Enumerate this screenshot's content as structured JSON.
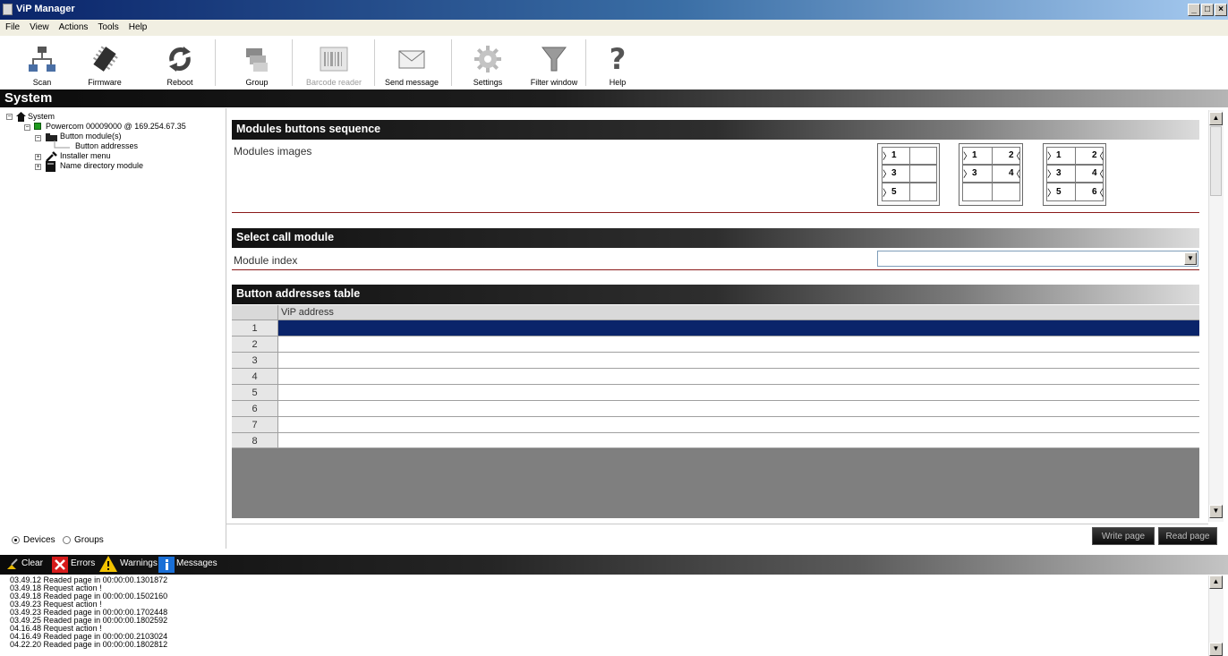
{
  "window": {
    "title": "ViP Manager",
    "controls": [
      "_",
      "□",
      "×"
    ]
  },
  "menu": [
    "File",
    "View",
    "Actions",
    "Tools",
    "Help"
  ],
  "toolbar": [
    {
      "label": "Scan",
      "icon": "network-icon",
      "enabled": true
    },
    {
      "label": "Firmware",
      "icon": "chip-icon",
      "enabled": true
    },
    {
      "label": "Reboot",
      "icon": "reboot-arrows-icon",
      "enabled": true
    },
    {
      "label": "Group",
      "icon": "group-icon",
      "enabled": true
    },
    {
      "label": "Barcode reader",
      "icon": "barcode-icon",
      "enabled": false
    },
    {
      "label": "Send message",
      "icon": "envelope-icon",
      "enabled": true
    },
    {
      "label": "Settings",
      "icon": "gear-icon",
      "enabled": true
    },
    {
      "label": "Filter window",
      "icon": "funnel-icon",
      "enabled": true
    },
    {
      "label": "Help",
      "icon": "question-icon",
      "enabled": true
    }
  ],
  "section_title": "System",
  "tree": {
    "root": "System",
    "device": "Powercom 00009000 @ 169.254.67.35",
    "button_modules": "Button module(s)",
    "button_addresses": "Button addresses",
    "installer_menu": "Installer menu",
    "name_directory": "Name directory module"
  },
  "view_mode": {
    "devices": "Devices",
    "groups": "Groups",
    "selected": "Devices"
  },
  "modules_sequence": {
    "header": "Modules buttons sequence",
    "label": "Modules images",
    "images": [
      [
        [
          "1",
          ""
        ],
        [
          "3",
          ""
        ],
        [
          "5",
          ""
        ]
      ],
      [
        [
          "1",
          "2"
        ],
        [
          "3",
          "4"
        ],
        [
          "",
          ""
        ]
      ],
      [
        [
          "1",
          "2"
        ],
        [
          "3",
          "4"
        ],
        [
          "5",
          "6"
        ]
      ]
    ]
  },
  "select_module": {
    "header": "Select call module",
    "label": "Module index",
    "value": ""
  },
  "addresses_table": {
    "header": "Button addresses table",
    "column": "ViP address",
    "rows": [
      "1",
      "2",
      "3",
      "4",
      "5",
      "6",
      "7",
      "8"
    ],
    "selected_row": 1
  },
  "actions": {
    "write": "Write page",
    "read": "Read page"
  },
  "log_toolbar": {
    "clear": "Clear",
    "errors": "Errors",
    "warnings": "Warnings",
    "messages": "Messages"
  },
  "log": [
    "03.49.12  Readed page in 00:00:00.1301872",
    "03.49.18  Request action !",
    "03.49.18  Readed page in 00:00:00.1502160",
    "03.49.23  Request action !",
    "03.49.23  Readed page in 00:00:00.1702448",
    "03.49.25  Readed page in 00:00:00.1802592",
    "04.16.48  Request action !",
    "04.16.49  Readed page in 00:00:00.2103024",
    "04.22.20  Readed page in 00:00:00.1802812"
  ],
  "colors": {
    "selection": "#0a246a",
    "section_red_line": "#8b1a1a",
    "grid_background": "#7f7f7f"
  }
}
